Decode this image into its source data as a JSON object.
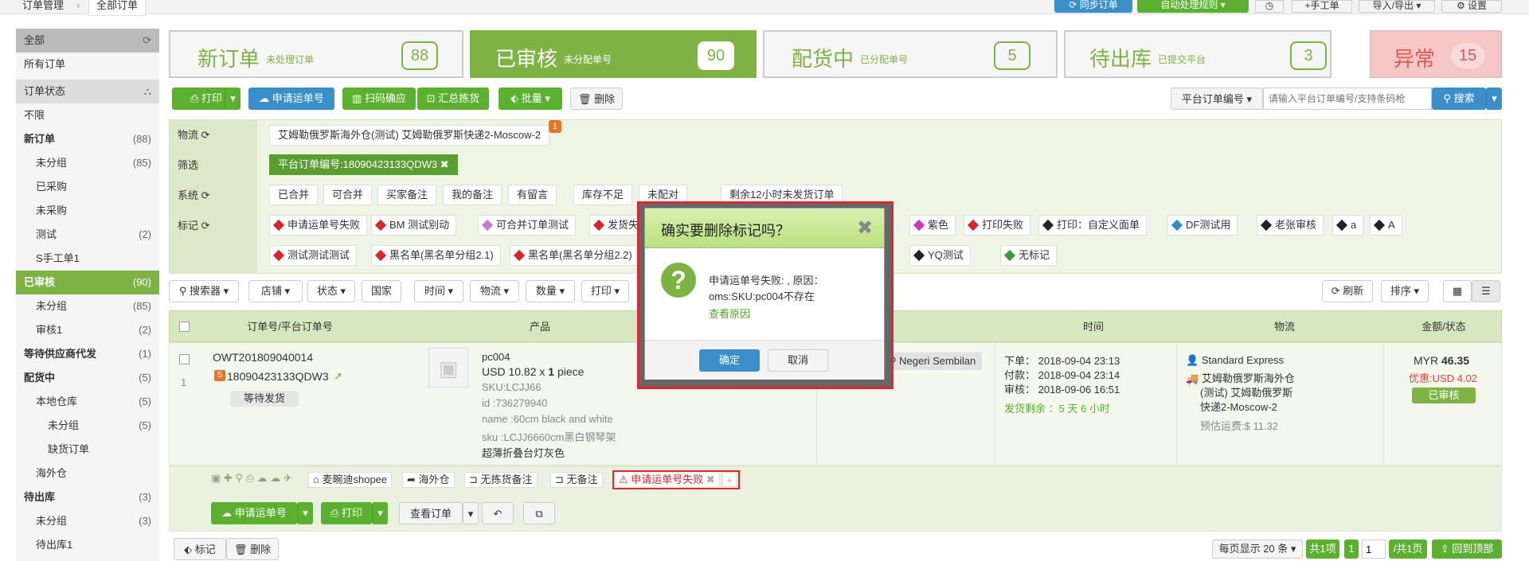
{
  "breadcrumb": {
    "root": "订单管理",
    "current": "全部订单"
  },
  "top_buttons": {
    "sync": "同步订单",
    "auto_rules": "自动处理规则",
    "manual": "手工单",
    "import_export": "导入/导出",
    "settings": "设置"
  },
  "sidebar": {
    "all": "全部",
    "all_orders": "所有订单",
    "order_status": "订单状态",
    "unlimited": "不限",
    "items": [
      {
        "label": "新订单",
        "count": "(88)"
      },
      {
        "label": "未分组",
        "count": "(85)"
      },
      {
        "label": "已采购",
        "count": ""
      },
      {
        "label": "未采购",
        "count": ""
      },
      {
        "label": "测试",
        "count": "(2)"
      },
      {
        "label": "S手工单1",
        "count": ""
      },
      {
        "label": "已审核",
        "count": "(90)"
      },
      {
        "label": "未分组",
        "count": "(85)"
      },
      {
        "label": "审核1",
        "count": "(2)"
      },
      {
        "label": "等待供应商代发",
        "count": "(1)"
      },
      {
        "label": "配货中",
        "count": "(5)"
      },
      {
        "label": "本地仓库",
        "count": "(5)"
      },
      {
        "label": "未分组",
        "count": "(5)"
      },
      {
        "label": "缺货订单",
        "count": ""
      },
      {
        "label": "海外仓",
        "count": ""
      },
      {
        "label": "待出库",
        "count": "(3)"
      },
      {
        "label": "未分组",
        "count": "(3)"
      },
      {
        "label": "待出库1",
        "count": ""
      }
    ]
  },
  "status_tabs": [
    {
      "title": "新订单",
      "sub": "未处理订单",
      "count": "88"
    },
    {
      "title": "已审核",
      "sub": "未分配单号",
      "count": "90"
    },
    {
      "title": "配货中",
      "sub": "已分配单号",
      "count": "5"
    },
    {
      "title": "待出库",
      "sub": "已提交平台",
      "count": "3"
    },
    {
      "title": "异常",
      "sub": "",
      "count": "15"
    }
  ],
  "toolbar": {
    "print": "打印",
    "apply_tracking": "申请运单号",
    "scan": "扫码确应",
    "pick": "汇总拣货",
    "batch": "批量",
    "delete": "删除",
    "search_type": "平台订单编号",
    "search_placeholder": "请输入平台订单编号/支持条码枪",
    "search": "搜索"
  },
  "filters": {
    "logistics_label": "物流",
    "logistics_chip": "艾姆勒俄罗斯海外仓(测试) 艾姆勒俄罗斯快递2-Moscow-2",
    "logistics_badge": "1",
    "screen_label": "筛选",
    "screen_chip": "平台订单编号:18090423133QDW3",
    "system_label": "系统",
    "system_chips": [
      "已合并",
      "可合并",
      "买家备注",
      "我的备注",
      "有留言",
      "库存不足",
      "未配对",
      "剩余12小时未发货订单"
    ],
    "tag_label": "标记",
    "tags_row1": [
      "申请运单号失败",
      "BM 测试别动",
      "可合并订单测试",
      "发货失败",
      "紫色",
      "打印失败",
      "打印：自定义面单",
      "DF测试用",
      "老张审核",
      "a",
      "A"
    ],
    "tags_row2": [
      "测试测试测试",
      "黑名单(黑名单分组2.1)",
      "黑名单(黑名单分组2.2)",
      "YQ测试",
      "无标记"
    ]
  },
  "sortbar": {
    "searcher": "搜索器",
    "shop": "店铺",
    "status": "状态",
    "country": "国家",
    "time": "时间",
    "logistics": "物流",
    "quantity": "数量",
    "print": "打印",
    "refresh": "刷新",
    "sort": "排序"
  },
  "table": {
    "headers": {
      "order": "订单号/平台订单号",
      "product": "产品",
      "time": "时间",
      "logistics": "物流",
      "amount": "金额/状态"
    },
    "row": {
      "index": "1",
      "order_no": "OWT201809040014",
      "platform_no": "18090423133QDW3",
      "wait": "等待发货",
      "sku_name": "pc004",
      "price": "USD 10.82 x",
      "qty": "1",
      "unit": "piece",
      "sku": "SKU:LCJJ66",
      "id": "id :736279940",
      "name": "name :60cm black and white",
      "sku2": "sku :LCJJ6660cm黑白钢琴架",
      "title": "超薄折叠台灯灰色",
      "region": "Negeri Sembilan",
      "ordered": "下单：  2018-09-04 23:13",
      "paid": "付款：  2018-09-04 23:14",
      "reviewed": "审核：  2018-09-06 16:51",
      "remain": "发货剩余 ：5 天 6 小时",
      "carrier": "Standard Express",
      "warehouse1": "艾姆勒俄罗斯海外仓",
      "warehouse2": "(测试) 艾姆勒俄罗斯",
      "warehouse3": "快递2-Moscow-2",
      "est_fee": "预估运费:$ 11.32",
      "currency": "MYR",
      "amount": "46.35",
      "discount": "优惠:USD 4.02",
      "status": "已审核",
      "shop": "麦畹迪shopee",
      "overseas": "海外仓",
      "no_pick_note": "无拣货备注",
      "no_note": "无备注",
      "fail_tag": "申请运单号失败"
    },
    "actions": {
      "apply": "申请运单号",
      "print": "打印",
      "view": "查看订单"
    }
  },
  "bottom": {
    "mark": "标记",
    "delete": "删除",
    "per_page": "每页显示 20 条",
    "total": "共1项",
    "page": "1",
    "pages": "/共1页",
    "back_top": "回到顶部"
  },
  "modal": {
    "title": "确实要删除标记吗？",
    "message1": "申请运单号失败: , 原因：",
    "message2": "oms:SKU:pc004不存在",
    "link": "查看原因",
    "ok": "确定",
    "cancel": "取消"
  }
}
